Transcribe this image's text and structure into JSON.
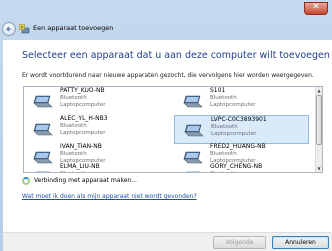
{
  "window": {
    "title": "Een apparaat toevoegen",
    "close_glyph": "✕"
  },
  "header": {
    "heading": "Selecteer een apparaat dat u aan deze computer wilt toevoegen"
  },
  "description": "Er wordt voortdurend naar nieuwe apparaten gezocht, die vervolgens hier worden weergegeven.",
  "devices": [
    {
      "name": "PATTY_KUO-NB",
      "type": "Bluetooth",
      "category": "Laptopcomputer",
      "selected": false
    },
    {
      "name": "S101",
      "type": "Bluetooth",
      "category": "Laptopcomputer",
      "selected": false
    },
    {
      "name": "ALEC_YL_H-NB3",
      "type": "Bluetooth",
      "category": "Laptopcomputer",
      "selected": false
    },
    {
      "name": "LVPC-C0C3893901",
      "type": "Bluetooth",
      "category": "Laptopcomputer",
      "selected": true
    },
    {
      "name": "IVAN_TIAN-NB",
      "type": "Bluetooth",
      "category": "Laptopcomputer",
      "selected": false
    },
    {
      "name": "FRED2_HUANG-NB",
      "type": "Bluetooth",
      "category": "Laptopcomputer",
      "selected": false
    },
    {
      "name": "ELMA_LIU-NB",
      "type": "Bluetooth",
      "category": "",
      "selected": false
    },
    {
      "name": "GORY_CHENG-NB",
      "type": "Bluetooth",
      "category": "",
      "selected": false
    }
  ],
  "status": {
    "text": "Verbinding met apparaat maken..."
  },
  "help_link": "Wat moet ik doen als mijn apparaat niet wordt gevonden?",
  "buttons": {
    "next": "Volgende",
    "cancel": "Annuleren"
  },
  "colors": {
    "heading": "#1e3f8c",
    "link": "#1c4fa8",
    "selected_bg": "#d9ebfb",
    "close_red": "#c9472f"
  }
}
